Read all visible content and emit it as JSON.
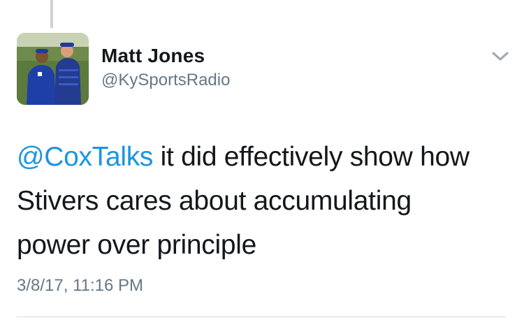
{
  "tweet": {
    "author": {
      "display_name": "Matt Jones",
      "handle": "@KySportsRadio",
      "avatar": "profile-photo"
    },
    "menu_icon": "chevron-down-icon",
    "text": {
      "mention": "@CoxTalks",
      "line1_rest": " it did effectively show how",
      "line2": "Stivers cares about accumulating",
      "line3": "power over principle"
    },
    "timestamp": "3/8/17, 11:16 PM"
  },
  "colors": {
    "link": "#1b95e0",
    "secondary_text": "#657786",
    "primary_text": "#14171a",
    "divider": "#d6dbe0"
  }
}
